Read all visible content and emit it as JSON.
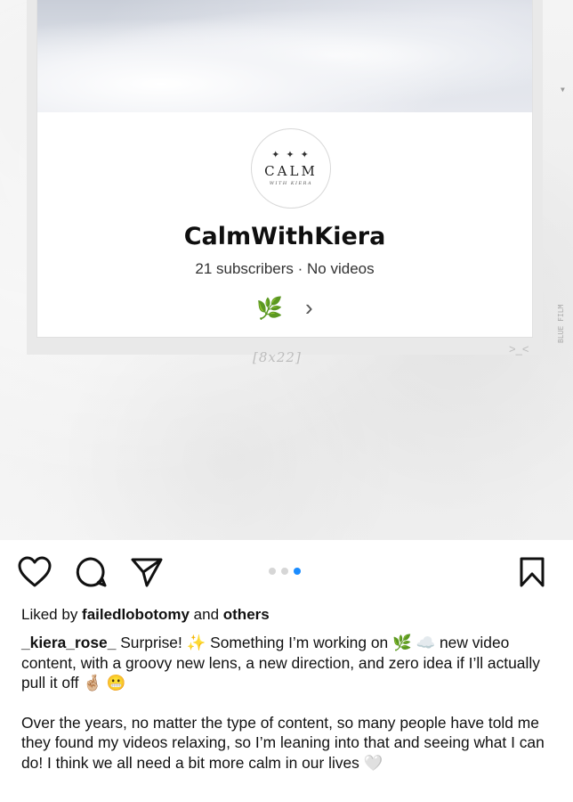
{
  "post_image": {
    "channel": {
      "logo_stars": "✦ ✦ ✦",
      "logo_word": "CALM",
      "logo_sub": "WITH KIERA",
      "name": "CalmWithKiera",
      "stats": "21 subscribers · No videos",
      "leaf_emoji": "🌿",
      "chevron": "›"
    },
    "film_code": "[8x22]",
    "film_arrow": ">_<",
    "film_edge_label": "BLUE FILM"
  },
  "actions": {
    "icons": [
      "heart-icon",
      "comment-icon",
      "share-icon",
      "bookmark-icon"
    ],
    "carousel": {
      "count": 3,
      "active_index": 2,
      "active_color": "#1a8cff"
    }
  },
  "likes": {
    "prefix": "Liked by ",
    "user": "failedlobotomy",
    "middle": " and ",
    "others": "others"
  },
  "caption": {
    "username": "_kiera_rose_",
    "paragraph1": " Surprise! ✨ Something I’m working on 🌿 ☁️ new video content, with a groovy new lens, a new direction, and zero idea if I’ll actually pull it off 🤞🏼 😬",
    "paragraph2": "Over the years, no matter the type of content, so many people have told me they found my videos relaxing, so I’m leaning into that and seeing what I can do! I think we all need a bit more calm in our lives 🤍"
  }
}
